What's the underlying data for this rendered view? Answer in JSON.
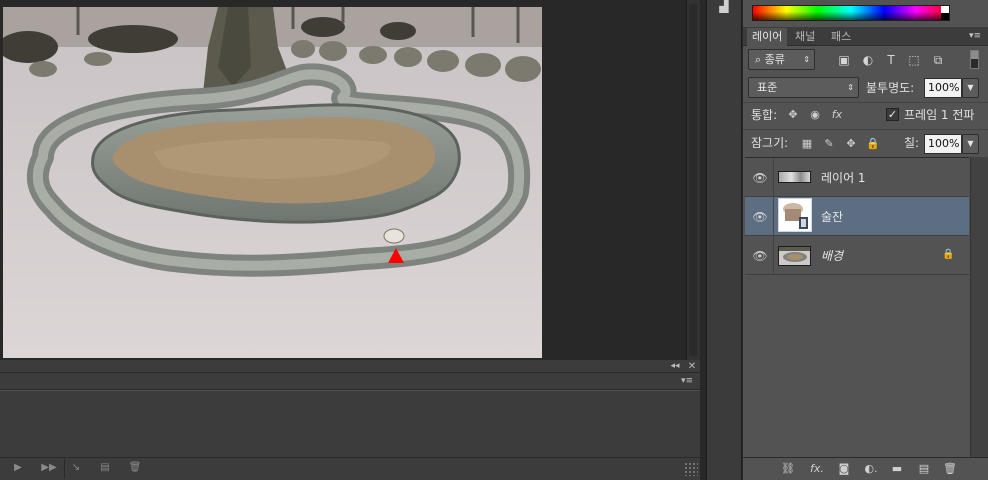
{
  "app": {
    "accent": "#5e6e82",
    "background": "#282828",
    "panel": "#535353"
  },
  "document": {
    "image_description": "photo of a stone water-channel structure (Poseokjeong) on snowy ground with a tree",
    "marker_color": "#ff0000"
  },
  "timeline": {
    "collapse_icon": "double-chevron-left-icon",
    "close_icon": "close-icon",
    "menu_icon": "panel-menu-icon",
    "footer_buttons": [
      {
        "name": "play-icon",
        "glyph": "▶"
      },
      {
        "name": "fast-forward-icon",
        "glyph": "▶▶"
      },
      {
        "name": "tween-icon",
        "glyph": "↘"
      },
      {
        "name": "duplicate-frame-icon",
        "glyph": "▤"
      },
      {
        "name": "trash-icon",
        "glyph": "🗑"
      }
    ]
  },
  "tools": {
    "brush_icon": "brush-tool-icon"
  },
  "color_panel": {
    "spectrum": true
  },
  "layers_panel": {
    "tabs": [
      {
        "label": "레이어",
        "active": true
      },
      {
        "label": "채널",
        "active": false
      },
      {
        "label": "패스",
        "active": false
      }
    ],
    "filter": {
      "kind_label": "종류",
      "kind_icon": "search-icon",
      "icons": [
        "image-filter-icon",
        "adjustment-filter-icon",
        "type-filter-icon",
        "shape-filter-icon",
        "smart-object-filter-icon"
      ]
    },
    "blend_mode": "표준",
    "opacity_label": "불투명도:",
    "opacity_value": "100%",
    "unify_label": "통합:",
    "propagate_label": "프레임 1 전파",
    "propagate_checked": true,
    "lock_label": "잠그기:",
    "fill_label": "칠:",
    "fill_value": "100%",
    "layers": [
      {
        "name": "레이어 1",
        "selected": false,
        "visible": true,
        "locked": false,
        "italic": false
      },
      {
        "name": "술잔",
        "selected": true,
        "visible": true,
        "locked": false,
        "italic": false
      },
      {
        "name": "배경",
        "selected": false,
        "visible": true,
        "locked": true,
        "italic": true
      }
    ],
    "footer_icons": [
      "link-layers-icon",
      "fx-icon",
      "add-mask-icon",
      "adjustment-layer-icon",
      "group-folder-icon",
      "new-layer-icon",
      "trash-icon"
    ]
  }
}
